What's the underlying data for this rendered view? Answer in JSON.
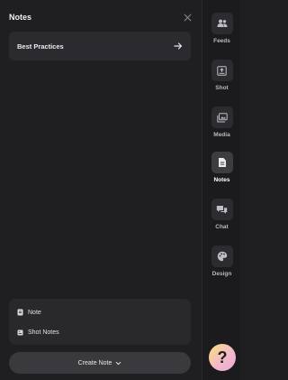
{
  "panel": {
    "title": "Notes",
    "close_icon": "close-icon",
    "notes": [
      {
        "title": "Best Practices",
        "icon": "arrow-right-icon"
      }
    ]
  },
  "menu": {
    "items": [
      {
        "label": "Note",
        "icon": "note-icon"
      },
      {
        "label": "Shot Notes",
        "icon": "shot-notes-icon"
      }
    ]
  },
  "create_button": {
    "label": "Create Note",
    "icon": "chevron-down-icon"
  },
  "sidebar": {
    "items": [
      {
        "label": "Feeds",
        "icon": "users-icon",
        "active": false
      },
      {
        "label": "Shot",
        "icon": "shot-icon",
        "active": false
      },
      {
        "label": "Media",
        "icon": "media-icon",
        "active": false
      },
      {
        "label": "Notes",
        "icon": "notes-icon",
        "active": true
      },
      {
        "label": "Chat",
        "icon": "chat-icon",
        "active": false
      },
      {
        "label": "Design",
        "icon": "palette-icon",
        "active": false
      }
    ]
  },
  "help_button": {
    "label": "?"
  },
  "colors": {
    "background": "#1f1f21",
    "sidebar": "#1b1b1d",
    "card": "#2b2b2f",
    "active_icon_bg": "#3c3c41"
  }
}
